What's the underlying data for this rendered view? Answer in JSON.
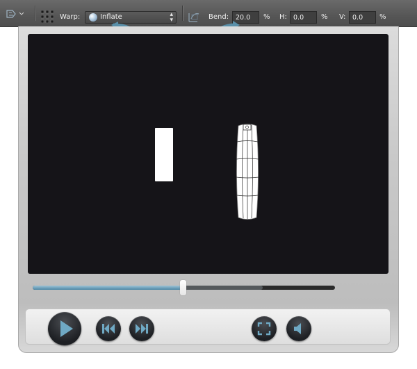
{
  "toolbar": {
    "warp_label": "Warp:",
    "warp_value": "Inflate",
    "bend_label": "Bend:",
    "bend_value": "20.0",
    "bend_unit": "%",
    "h_label": "H:",
    "h_value": "0.0",
    "h_unit": "%",
    "v_label": "V:",
    "v_value": "0.0",
    "v_unit": "%"
  },
  "player": {
    "seek_progress": 0.496,
    "buffered_progress": 0.76,
    "controls": [
      "play",
      "previous",
      "next",
      "fullscreen",
      "volume"
    ]
  },
  "colors": {
    "accent": "#5a8fa8",
    "toolbar_bg": "#5a5a5a",
    "video_bg": "#151418",
    "button_dark": "#222428"
  }
}
